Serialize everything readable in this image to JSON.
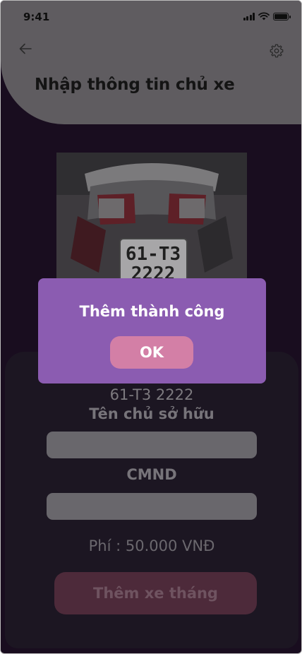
{
  "status_bar": {
    "time": "9:41"
  },
  "header": {
    "back_icon": "arrow-left-icon",
    "settings_icon": "gear-icon",
    "title": "Nhập thông tin chủ xe"
  },
  "photo": {
    "plate_line1": "61-T3",
    "plate_line2": "2222"
  },
  "form": {
    "plate_number": "61-T3 2222",
    "owner_label": "Tên chủ sở hữu",
    "owner_value": "",
    "id_label": "CMND",
    "id_value": "",
    "fee_text": "Phí : 50.000 VNĐ",
    "submit_label": "Thêm xe tháng"
  },
  "dialog": {
    "title": "Thêm thành công",
    "ok_label": "OK"
  },
  "colors": {
    "background": "#190d1f",
    "header": "#5f5c60",
    "dialog": "#8b5cb1",
    "ok_button": "#d37fa6",
    "submit_button": "#4d2a3a"
  }
}
